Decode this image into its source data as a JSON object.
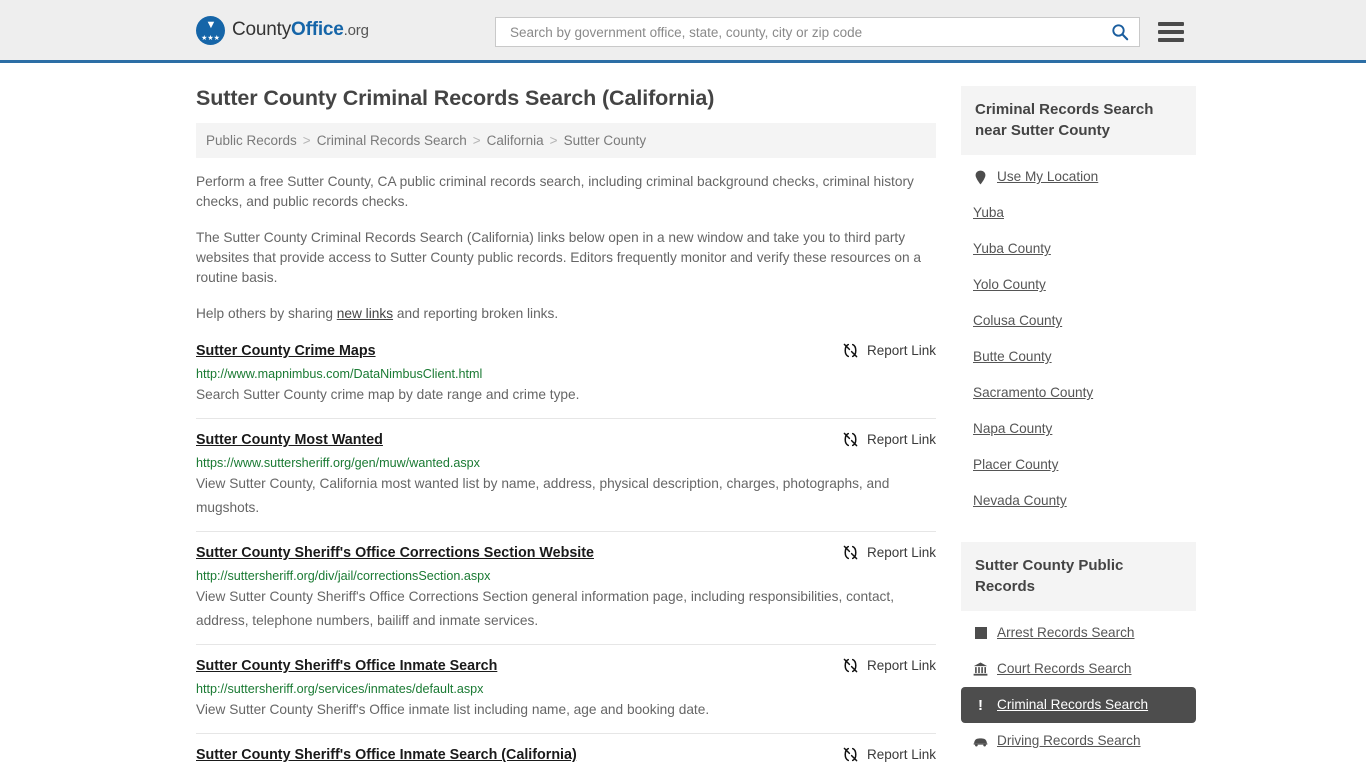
{
  "header": {
    "logo": {
      "part1": "County",
      "part2": "Office",
      "part3": ".org",
      "icon": "eagle-seal-icon"
    },
    "search": {
      "placeholder": "Search by government office, state, county, city or zip code",
      "value": ""
    },
    "search_icon": "search-icon",
    "menu_icon": "hamburger-menu-icon"
  },
  "main": {
    "page_title": "Sutter County Criminal Records Search (California)",
    "breadcrumb": [
      {
        "label": "Public Records"
      },
      {
        "label": "Criminal Records Search"
      },
      {
        "label": "California"
      },
      {
        "label": "Sutter County"
      }
    ],
    "breadcrumb_separator": ">",
    "intro": {
      "p1": "Perform a free Sutter County, CA public criminal records search, including criminal background checks, criminal history checks, and public records checks.",
      "p2": "The Sutter County Criminal Records Search (California) links below open in a new window and take you to third party websites that provide access to Sutter County public records. Editors frequently monitor and verify these resources on a routine basis.",
      "p3_before": "Help others by sharing ",
      "p3_link": "new links",
      "p3_after": " and reporting broken links."
    },
    "report_link_label": "Report Link",
    "report_link_icon": "broken-link-icon",
    "results": [
      {
        "title": "Sutter County Crime Maps",
        "url": "http://www.mapnimbus.com/DataNimbusClient.html",
        "description": "Search Sutter County crime map by date range and crime type."
      },
      {
        "title": "Sutter County Most Wanted",
        "url": "https://www.suttersheriff.org/gen/muw/wanted.aspx",
        "description": "View Sutter County, California most wanted list by name, address, physical description, charges, photographs, and mugshots."
      },
      {
        "title": "Sutter County Sheriff's Office Corrections Section Website",
        "url": "http://suttersheriff.org/div/jail/correctionsSection.aspx",
        "description": "View Sutter County Sheriff's Office Corrections Section general information page, including responsibilities, contact, address, telephone numbers, bailiff and inmate services."
      },
      {
        "title": "Sutter County Sheriff's Office Inmate Search",
        "url": "http://suttersheriff.org/services/inmates/default.aspx",
        "description": "View Sutter County Sheriff's Office inmate list including name, age and booking date."
      },
      {
        "title": "Sutter County Sheriff's Office Inmate Search (California)",
        "url": "",
        "description": ""
      }
    ]
  },
  "sidebar": {
    "nearby": {
      "heading": "Criminal Records Search near Sutter County",
      "items": [
        {
          "label": "Use My Location",
          "icon": "map-pin-icon"
        },
        {
          "label": "Yuba",
          "icon": ""
        },
        {
          "label": "Yuba County",
          "icon": ""
        },
        {
          "label": "Yolo County",
          "icon": ""
        },
        {
          "label": "Colusa County",
          "icon": ""
        },
        {
          "label": "Butte County",
          "icon": ""
        },
        {
          "label": "Sacramento County",
          "icon": ""
        },
        {
          "label": "Napa County",
          "icon": ""
        },
        {
          "label": "Placer County",
          "icon": ""
        },
        {
          "label": "Nevada County",
          "icon": ""
        }
      ]
    },
    "public_records": {
      "heading": "Sutter County Public Records",
      "items": [
        {
          "label": "Arrest Records Search",
          "icon": "square-icon",
          "active": false
        },
        {
          "label": "Court Records Search",
          "icon": "courthouse-icon",
          "active": false
        },
        {
          "label": "Criminal Records Search",
          "icon": "exclamation-icon",
          "active": true
        },
        {
          "label": "Driving Records Search",
          "icon": "car-icon",
          "active": false
        }
      ]
    }
  },
  "colors": {
    "header_bg": "#eeeeee",
    "header_border": "#2c6ea5",
    "brand_blue": "#1565a8",
    "url_green": "#1a7a33",
    "band_gray": "#f4f4f4",
    "active_dark": "#4d4d4d"
  }
}
